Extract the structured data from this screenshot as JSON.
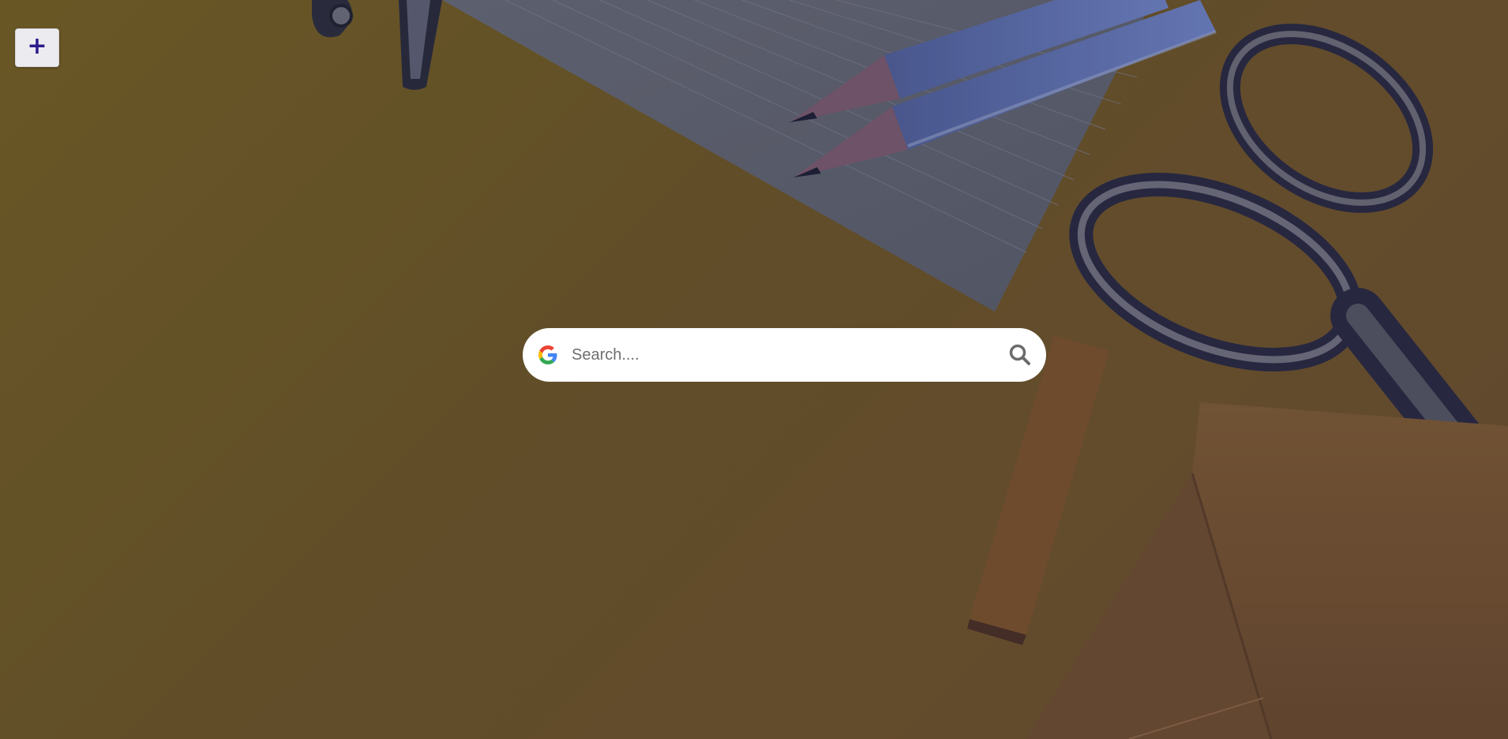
{
  "add_button": {
    "label": "+"
  },
  "search": {
    "placeholder": "Search....",
    "value": "",
    "engine_icon": "google-g-icon",
    "submit_icon": "search-icon"
  },
  "background": {
    "description_colors": {
      "desk": "#6e5a23",
      "overlay": "#1a1a4a"
    }
  }
}
